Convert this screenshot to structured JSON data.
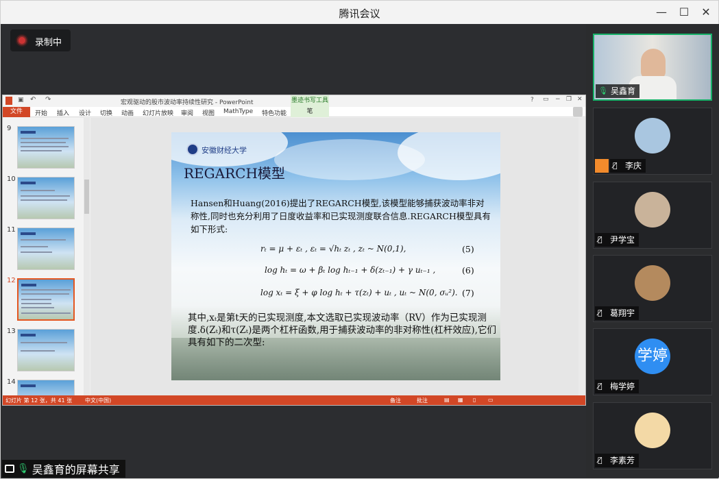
{
  "window": {
    "title": "腾讯会议",
    "controls": [
      "—",
      "☐",
      "✕"
    ]
  },
  "recording": {
    "label": "录制中"
  },
  "screen_share": {
    "label": "吴鑫育的屏幕共享"
  },
  "ppt": {
    "title": "宏观驱动的股市波动率持续性研究 - PowerPoint",
    "context_tab": "墨迹书写工具",
    "tabs": [
      "文件",
      "开始",
      "插入",
      "设计",
      "切换",
      "动画",
      "幻灯片放映",
      "审阅",
      "视图",
      "MathType",
      "特色功能",
      "笔"
    ],
    "thumb_numbers": [
      "9",
      "10",
      "11",
      "12",
      "13",
      "14"
    ],
    "selected_slide": "12",
    "status_left": "幻灯片 第 12 张，共 41 张",
    "status_lang": "中文(中国)",
    "status_notes": "备注",
    "status_comments": "批注",
    "slide": {
      "logo_text": "安徽财经大学",
      "heading": "REGARCH模型",
      "para1": "Hansen和Huang(2016)提出了REGARCH模型,该模型能够捕获波动率非对称性,同时也充分利用了日度收益率和已实现测度联合信息.REGARCH模型具有如下形式:",
      "eq1": "rₜ = μ + εₜ ,   εₜ = √hₜ zₜ ,   zₜ ~ N(0,1),",
      "eq1_num": "(5)",
      "eq2": "log hₜ = ω + βₜ log hₜ₋₁ + δ(zₜ₋₁) + γ uₜ₋₁ ,",
      "eq2_num": "(6)",
      "eq3": "log xₜ = ξ + φ log hₜ + τ(zₜ) + uₜ ,     uₜ ~ N(0, σᵤ²).",
      "eq3_num": "(7)",
      "para2": "其中,xₜ是第t天的已实现测度,本文选取已实现波动率（RV）作为已实现测度.δ(Zₜ)和τ(Zₜ)是两个杠杆函数,用于捕获波动率的非对称性(杠杆效应),它们具有如下的二次型:"
    }
  },
  "participants": [
    {
      "name": "吴鑫育",
      "active": true
    },
    {
      "name": "李庆",
      "active": false
    },
    {
      "name": "尹学宝",
      "active": false
    },
    {
      "name": "葛翔宇",
      "active": false
    },
    {
      "name": "梅学婷",
      "active": false,
      "avatar_text": "学婷"
    },
    {
      "name": "李素芳",
      "active": false
    }
  ]
}
